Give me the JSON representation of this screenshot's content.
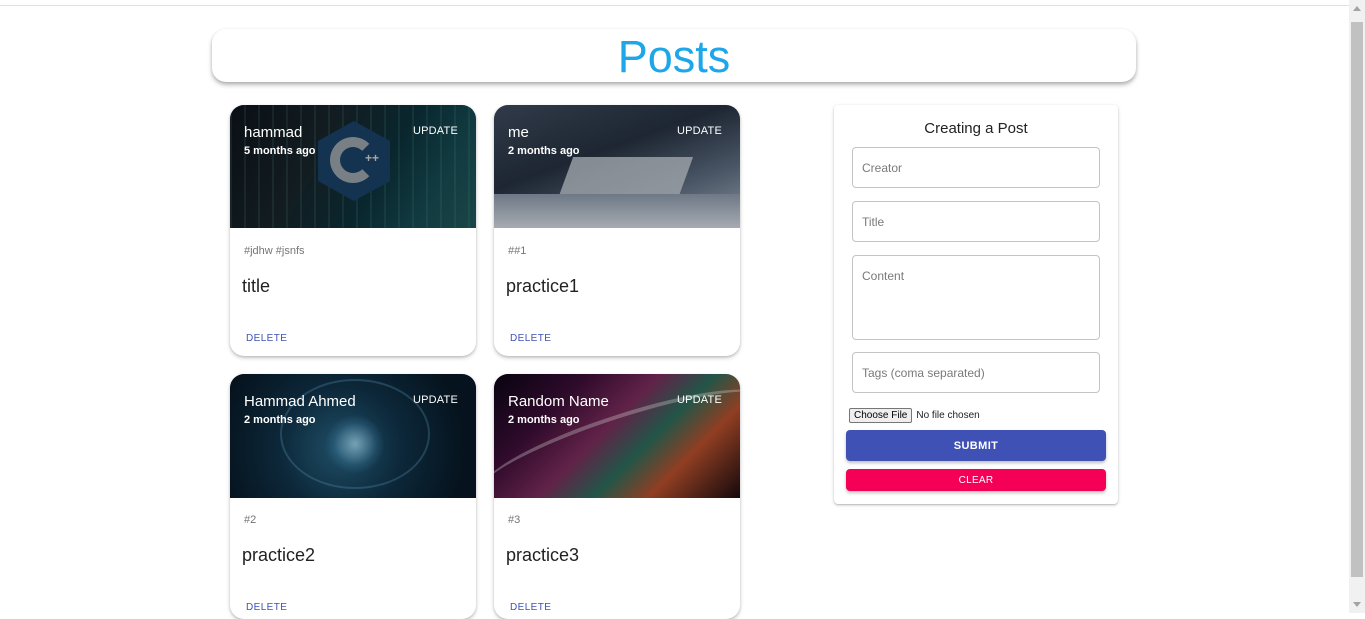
{
  "header": {
    "title": "Posts"
  },
  "posts": [
    {
      "creator": "hammad",
      "time": "5 months ago",
      "update_label": "UPDATE",
      "tags": "#jdhw #jsnfs",
      "title": "title",
      "delete_label": "DELETE",
      "image": "cpp-logo"
    },
    {
      "creator": "me",
      "time": "2 months ago",
      "update_label": "UPDATE",
      "tags": "##1",
      "title": "practice1",
      "delete_label": "DELETE",
      "image": "laptop-typing"
    },
    {
      "creator": "Hammad Ahmed",
      "time": "2 months ago",
      "update_label": "UPDATE",
      "tags": "#2",
      "title": "practice2",
      "delete_label": "DELETE",
      "image": "ai-hand"
    },
    {
      "creator": "Random Name",
      "time": "2 months ago",
      "update_label": "UPDATE",
      "tags": "#3",
      "title": "practice3",
      "delete_label": "DELETE",
      "image": "abstract-colors"
    }
  ],
  "form": {
    "heading": "Creating a Post",
    "creator_placeholder": "Creator",
    "title_placeholder": "Title",
    "content_placeholder": "Content",
    "tags_placeholder": "Tags (coma separated)",
    "file_button": "Choose File",
    "file_status": "No file chosen",
    "submit_label": "SUBMIT",
    "clear_label": "CLEAR"
  },
  "colors": {
    "title": "#1da6e8",
    "primary": "#3f51b5",
    "secondary": "#f50057"
  }
}
